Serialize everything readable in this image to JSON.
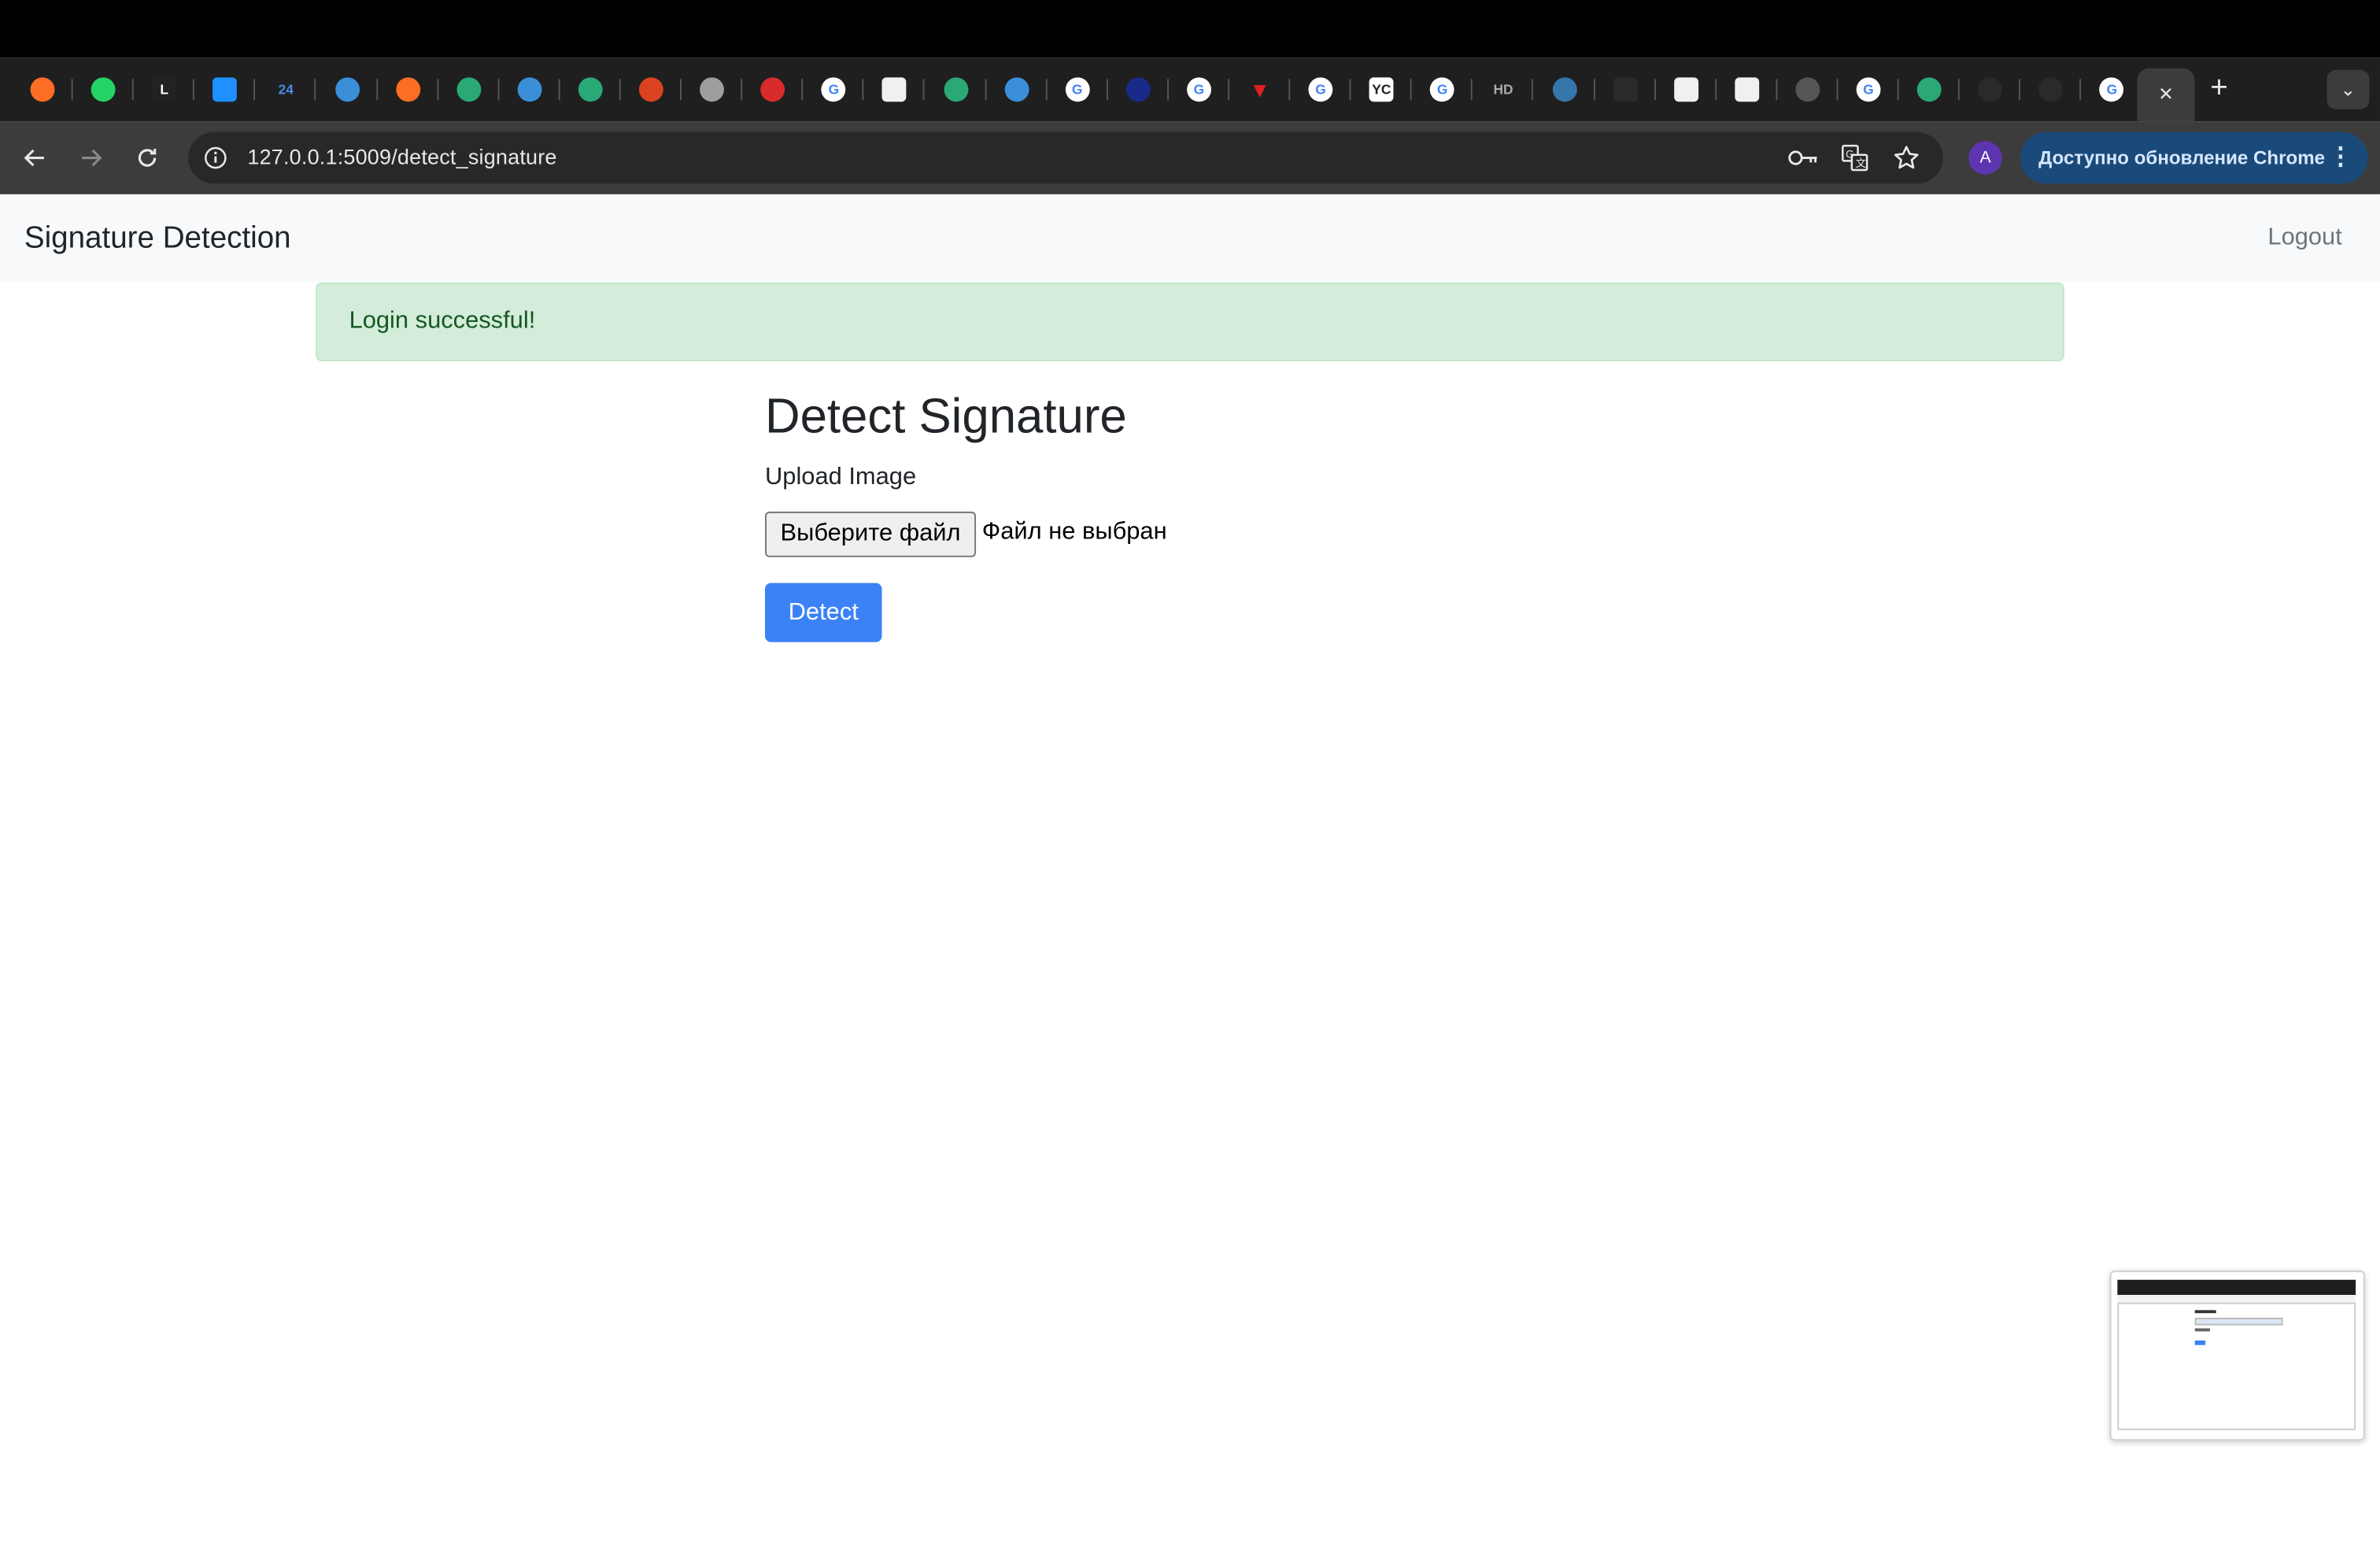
{
  "browser": {
    "active_tab_close": "×",
    "new_tab": "+",
    "tab_search": "⌄",
    "address": "127.0.0.1:5009/detect_signature",
    "profile_initial": "A",
    "update_label": "Доступно обновление Chrome",
    "update_menu": "⋮",
    "tabs": [
      {
        "icon": "gitlab-icon",
        "color": "#fc6d26",
        "glyph": ""
      },
      {
        "icon": "whatsapp-icon",
        "color": "#25d366",
        "glyph": ""
      },
      {
        "icon": "l-app-icon",
        "color": "#222222",
        "glyph": "L"
      },
      {
        "icon": "messages-icon",
        "color": "#1e90ff",
        "glyph": ""
      },
      {
        "icon": "24-icon",
        "color": "#1f1f1f",
        "glyph": "24"
      },
      {
        "icon": "uchet-blue-icon",
        "color": "#3b8fd9",
        "glyph": ""
      },
      {
        "icon": "gitlab-icon",
        "color": "#fc6d26",
        "glyph": ""
      },
      {
        "icon": "feather-green-icon",
        "color": "#2aa876",
        "glyph": ""
      },
      {
        "icon": "uchet-blue-icon",
        "color": "#3b8fd9",
        "glyph": ""
      },
      {
        "icon": "feather-green-icon",
        "color": "#2aa876",
        "glyph": ""
      },
      {
        "icon": "red-blob-icon",
        "color": "#d9431f",
        "glyph": ""
      },
      {
        "icon": "target-icon",
        "color": "#9e9e9e",
        "glyph": ""
      },
      {
        "icon": "uchet-red-icon",
        "color": "#d92b2b",
        "glyph": ""
      },
      {
        "icon": "google-icon",
        "color": "#ffffff",
        "glyph": "G"
      },
      {
        "icon": "cube-icon",
        "color": "#f0f0f0",
        "glyph": ""
      },
      {
        "icon": "feather-green-icon",
        "color": "#2aa876",
        "glyph": ""
      },
      {
        "icon": "uchet-blue-icon",
        "color": "#3b8fd9",
        "glyph": ""
      },
      {
        "icon": "google-icon",
        "color": "#ffffff",
        "glyph": "G"
      },
      {
        "icon": "dark-blue-icon",
        "color": "#1a2a8a",
        "glyph": ""
      },
      {
        "icon": "google-icon",
        "color": "#ffffff",
        "glyph": "G"
      },
      {
        "icon": "red-triangle-icon",
        "color": "#e02020",
        "glyph": ""
      },
      {
        "icon": "google-icon",
        "color": "#ffffff",
        "glyph": "G"
      },
      {
        "icon": "yc-icon",
        "color": "#ffffff",
        "glyph": "YC"
      },
      {
        "icon": "google-icon",
        "color": "#ffffff",
        "glyph": "G"
      },
      {
        "icon": "hd-icon",
        "color": "#1f1f1f",
        "glyph": "HD"
      },
      {
        "icon": "python-icon",
        "color": "#3776ab",
        "glyph": ""
      },
      {
        "icon": "dark-square-icon",
        "color": "#2a2a2a",
        "glyph": ""
      },
      {
        "icon": "cube-icon",
        "color": "#f0f0f0",
        "glyph": ""
      },
      {
        "icon": "cube-icon",
        "color": "#f0f0f0",
        "glyph": ""
      },
      {
        "icon": "globe-icon",
        "color": "#555555",
        "glyph": ""
      },
      {
        "icon": "google-icon",
        "color": "#ffffff",
        "glyph": "G"
      },
      {
        "icon": "feather-green-icon",
        "color": "#2aa876",
        "glyph": ""
      },
      {
        "icon": "github-icon",
        "color": "#2a2a2a",
        "glyph": ""
      },
      {
        "icon": "github-icon",
        "color": "#2a2a2a",
        "glyph": ""
      },
      {
        "icon": "google-icon",
        "color": "#ffffff",
        "glyph": "G"
      }
    ]
  },
  "navbar": {
    "brand": "Signature Detection",
    "logout": "Logout"
  },
  "alert": {
    "message": "Login successful!"
  },
  "main": {
    "title": "Detect Signature",
    "upload_label": "Upload Image",
    "file_button": "Выберите файл",
    "file_status": "Файл не выбран",
    "detect_button": "Detect"
  },
  "colors": {
    "accent": "#3b82f6",
    "alert_bg": "#d4edda",
    "alert_text": "#155724",
    "update_pill": "#1a4a7a"
  }
}
